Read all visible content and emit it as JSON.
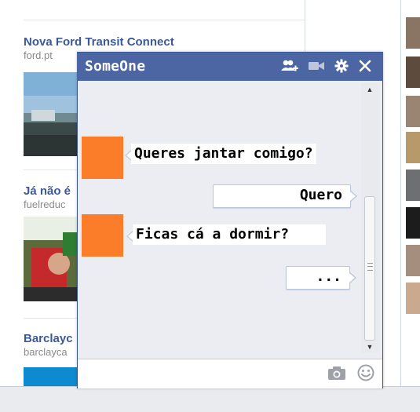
{
  "feed": {
    "ads": [
      {
        "title": "Nova Ford Transit Connect",
        "domain": "ford.pt"
      },
      {
        "title": "Já não é",
        "domain": "fuelreduc"
      },
      {
        "title": "Barclayc",
        "domain": "barclayca"
      }
    ]
  },
  "chat": {
    "title": "SomeOne",
    "header_icons": [
      "add-friend-icon",
      "video-call-icon",
      "settings-gear-icon",
      "close-icon"
    ],
    "messages": [
      {
        "direction": "incoming",
        "text": "Queres jantar comigo?"
      },
      {
        "direction": "outgoing",
        "text": "Quero"
      },
      {
        "direction": "incoming",
        "text": "Ficas cá a dormir?"
      },
      {
        "direction": "outgoing",
        "text": "..."
      }
    ],
    "composer": {
      "value": "",
      "placeholder": ""
    },
    "composer_icons": [
      "camera-icon",
      "emoji-icon"
    ],
    "colors": {
      "header": "#4c66a4",
      "avatar": "#fc7d29",
      "link": "#3b5998"
    }
  }
}
